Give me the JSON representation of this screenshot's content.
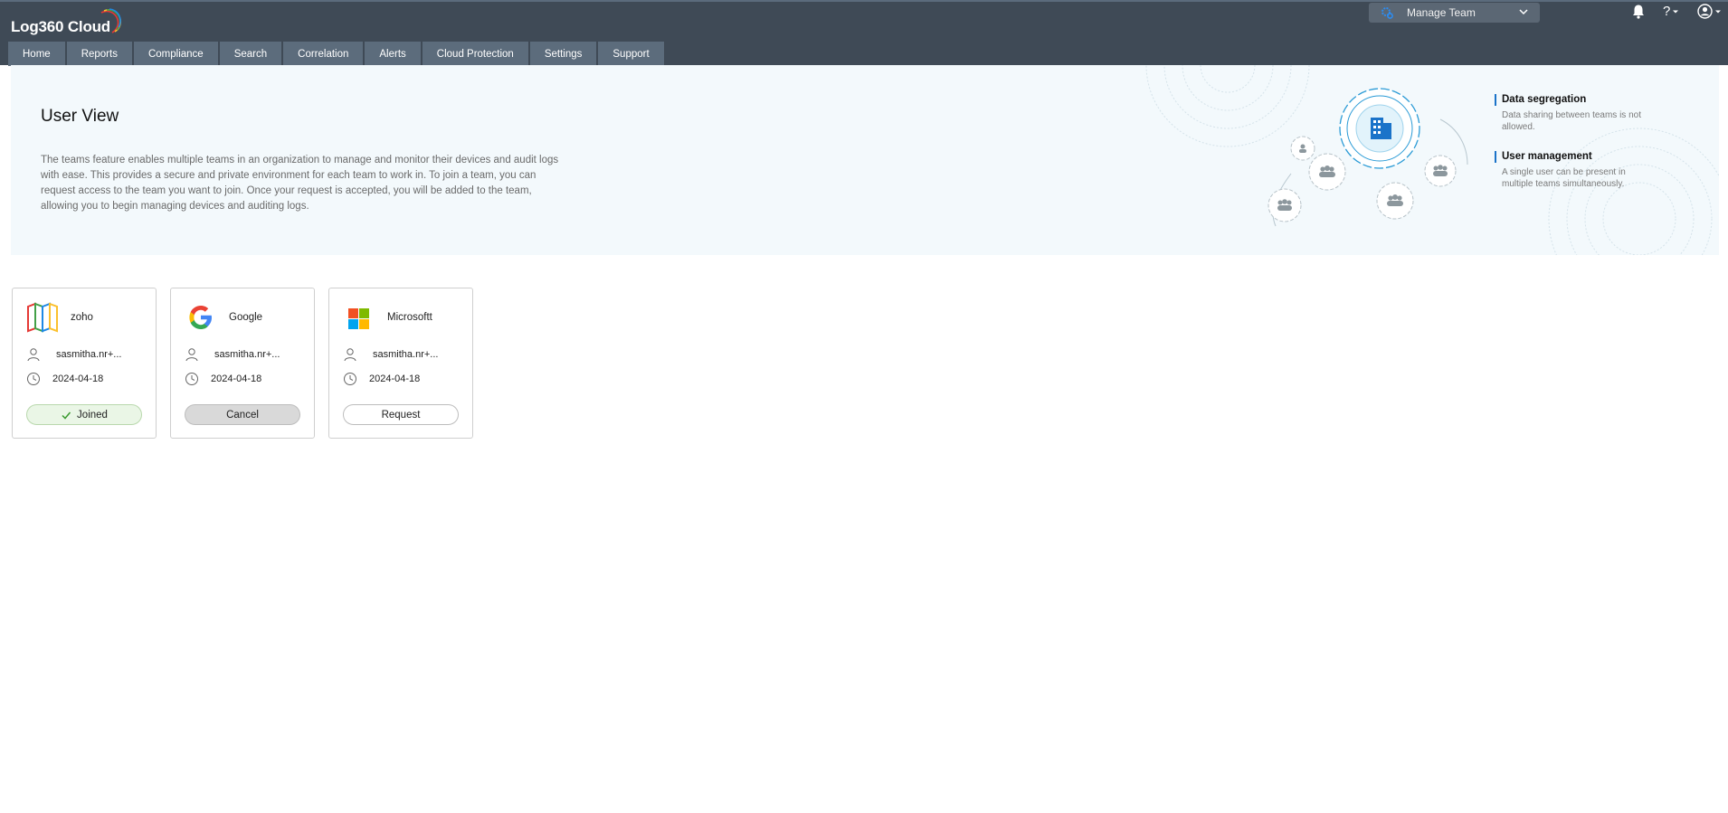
{
  "app": {
    "logo_text": "Log360  Cloud"
  },
  "header": {
    "team_select_label": "Manage Team",
    "help_label": "?"
  },
  "nav": {
    "items": [
      "Home",
      "Reports",
      "Compliance",
      "Search",
      "Correlation",
      "Alerts",
      "Cloud Protection",
      "Settings",
      "Support"
    ]
  },
  "banner": {
    "title": "User View",
    "description": "The teams feature enables multiple teams in an organization to manage and monitor their devices and audit logs with ease. This provides a secure and private environment for each team to work in. To join a team, you can request access to the team you want to join. Once your request is accepted, you will be added to the team, allowing you to begin managing devices and auditing logs.",
    "features": [
      {
        "title": "Data segregation",
        "desc": "Data sharing between teams is not allowed."
      },
      {
        "title": "User management",
        "desc": "A single user can be present in multiple teams simultaneously."
      }
    ]
  },
  "cards": [
    {
      "name": "zoho",
      "user": "sasmitha.nr+...",
      "date": "2024-04-18",
      "button": "Joined",
      "status": "joined"
    },
    {
      "name": "Google",
      "user": "sasmitha.nr+...",
      "date": "2024-04-18",
      "button": "Cancel",
      "status": "pending"
    },
    {
      "name": "Microsoftt",
      "user": "sasmitha.nr+...",
      "date": "2024-04-18",
      "button": "Request",
      "status": "available"
    }
  ],
  "colors": {
    "topbar": "#3f4a56",
    "nav_item": "#5c6c7c",
    "banner_bg": "#f3f9fc",
    "accent": "#1a73c9",
    "joined_bg": "#eaf6e6"
  }
}
